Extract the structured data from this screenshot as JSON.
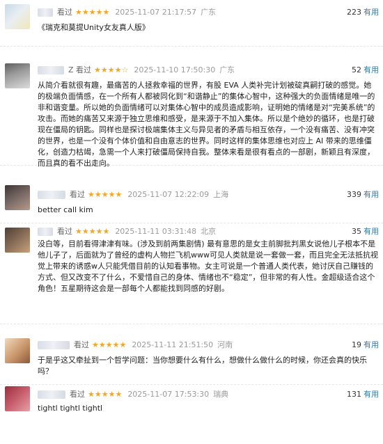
{
  "reviews": [
    {
      "status": "看过",
      "stars": "★★★★★",
      "date": "2025-11-07 21:17:57",
      "location": "广东",
      "useful_count": "223",
      "useful_label": "有用",
      "content": "《瑞克和莫提Unity女友真人版》",
      "avatar_colors": [
        "#c9d8e6",
        "#f2e7b8"
      ]
    },
    {
      "status": "Z 看过",
      "stars": "★★★★☆",
      "date": "2025-11-10 17:50:30",
      "location": "广东",
      "useful_count": "52",
      "useful_label": "有用",
      "content": "从简介看就很有趣，最痛苦的人拯救幸福的世界，有股 EVA 人类补完计划被碇真嗣打破的感觉。她的极端负面情感，在一个所有人都被同化到“和谐静止”的集体心智中，这种强大的负面情绪是唯一的非和谐变量。所以她的负面情绪可以对集体心智中的成员造成影响，证明她的情绪是对“完美系统”的攻击。而她的痛苦又来源于独立思维和感受，是来源于不加入集体。所以是个绝妙的循环，也是打破现在僵局的钥匙。同样也是探讨极端集体主义与异见者的矛盾与相互依存，一个没有痛苦、没有冲突的世界，也是一个没有个体价值和自由意志的世界。同时这样的集体思维也对应上 AI 带来的思维僵化，创造力枯竭，急需一个人来打破僵局保持自我。整体来看是很有看点的一部剧，新颖且有深度，而且真的看不出走向。",
      "avatar_colors": [
        "#6b6b6b",
        "#d9d9d9"
      ]
    },
    {
      "status": "看过",
      "stars": "★★★★★",
      "date": "2025-11-07 12:22:09",
      "location": "上海",
      "useful_count": "339",
      "useful_label": "有用",
      "content": "better call kim",
      "avatar_colors": [
        "#4a4040",
        "#b89a8a"
      ]
    },
    {
      "status": "看过",
      "stars": "★★★★★",
      "date": "2025-11-11 03:31:48",
      "location": "北京",
      "useful_count": "35",
      "useful_label": "有用",
      "content": "没白等，目前看得津津有味。(涉及到前两集剧情) 最有意思的是女主前脚批判黑女说他儿子根本不是他儿子了，后面就为了曾经的虚构人物拦飞机www可见人类就是说一套做一套，而且完全无法抵抗视觉上带来的诱惑w人只能凭借目前的认知看事物。女主可说是一个普通人类代表，她讨厌自己赚钱的方式、但又改变不了什么，不爱惜自己的身体、情绪也不“稳定”，但非常的有人性。金超级适合这个角色！五星期待这会是一部每个人都能找到同感的好剧。",
      "avatar_colors": [
        "#5a4a3a",
        "#c9a27a"
      ]
    },
    {
      "status": "看过",
      "stars": "★★★★★",
      "date": "2025-11-11 21:51:50",
      "location": "河南",
      "useful_count": "19",
      "useful_label": "有用",
      "content": "于是乎这又牵扯到一个哲学问题：当你想要什么有什么，想做什么做什么的时候，你还会真的快乐吗？",
      "avatar_colors": [
        "#e8c9a8",
        "#8a5a3a"
      ]
    },
    {
      "status": "看过",
      "stars": "★★★★★",
      "date": "2025-11-07 17:53:30",
      "location": "瑞典",
      "useful_count": "131",
      "useful_label": "有用",
      "content": "tightl tightl tightl",
      "avatar_colors": [
        "#b84a5a",
        "#e6a0a8"
      ]
    }
  ]
}
